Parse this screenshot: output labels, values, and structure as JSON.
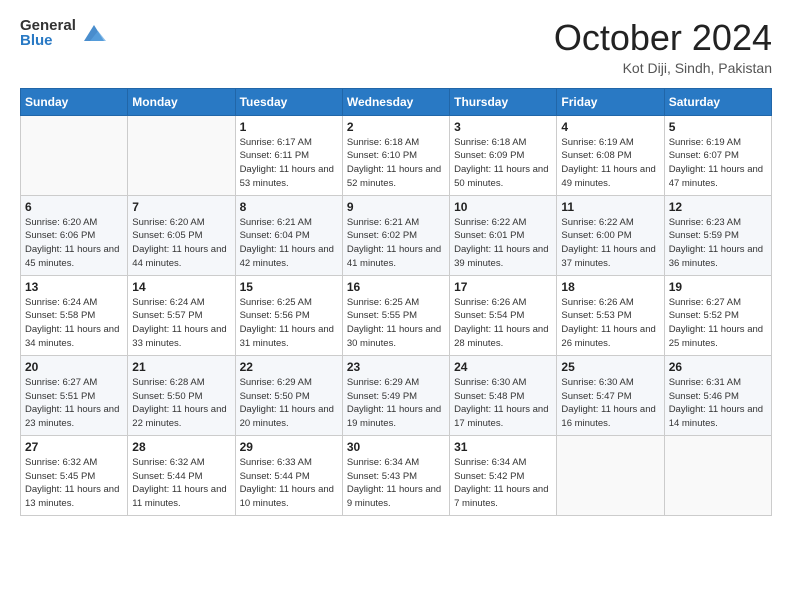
{
  "header": {
    "logo_general": "General",
    "logo_blue": "Blue",
    "month_title": "October 2024",
    "location": "Kot Diji, Sindh, Pakistan"
  },
  "weekdays": [
    "Sunday",
    "Monday",
    "Tuesday",
    "Wednesday",
    "Thursday",
    "Friday",
    "Saturday"
  ],
  "weeks": [
    [
      {
        "day": "",
        "info": ""
      },
      {
        "day": "",
        "info": ""
      },
      {
        "day": "1",
        "info": "Sunrise: 6:17 AM\nSunset: 6:11 PM\nDaylight: 11 hours and 53 minutes."
      },
      {
        "day": "2",
        "info": "Sunrise: 6:18 AM\nSunset: 6:10 PM\nDaylight: 11 hours and 52 minutes."
      },
      {
        "day": "3",
        "info": "Sunrise: 6:18 AM\nSunset: 6:09 PM\nDaylight: 11 hours and 50 minutes."
      },
      {
        "day": "4",
        "info": "Sunrise: 6:19 AM\nSunset: 6:08 PM\nDaylight: 11 hours and 49 minutes."
      },
      {
        "day": "5",
        "info": "Sunrise: 6:19 AM\nSunset: 6:07 PM\nDaylight: 11 hours and 47 minutes."
      }
    ],
    [
      {
        "day": "6",
        "info": "Sunrise: 6:20 AM\nSunset: 6:06 PM\nDaylight: 11 hours and 45 minutes."
      },
      {
        "day": "7",
        "info": "Sunrise: 6:20 AM\nSunset: 6:05 PM\nDaylight: 11 hours and 44 minutes."
      },
      {
        "day": "8",
        "info": "Sunrise: 6:21 AM\nSunset: 6:04 PM\nDaylight: 11 hours and 42 minutes."
      },
      {
        "day": "9",
        "info": "Sunrise: 6:21 AM\nSunset: 6:02 PM\nDaylight: 11 hours and 41 minutes."
      },
      {
        "day": "10",
        "info": "Sunrise: 6:22 AM\nSunset: 6:01 PM\nDaylight: 11 hours and 39 minutes."
      },
      {
        "day": "11",
        "info": "Sunrise: 6:22 AM\nSunset: 6:00 PM\nDaylight: 11 hours and 37 minutes."
      },
      {
        "day": "12",
        "info": "Sunrise: 6:23 AM\nSunset: 5:59 PM\nDaylight: 11 hours and 36 minutes."
      }
    ],
    [
      {
        "day": "13",
        "info": "Sunrise: 6:24 AM\nSunset: 5:58 PM\nDaylight: 11 hours and 34 minutes."
      },
      {
        "day": "14",
        "info": "Sunrise: 6:24 AM\nSunset: 5:57 PM\nDaylight: 11 hours and 33 minutes."
      },
      {
        "day": "15",
        "info": "Sunrise: 6:25 AM\nSunset: 5:56 PM\nDaylight: 11 hours and 31 minutes."
      },
      {
        "day": "16",
        "info": "Sunrise: 6:25 AM\nSunset: 5:55 PM\nDaylight: 11 hours and 30 minutes."
      },
      {
        "day": "17",
        "info": "Sunrise: 6:26 AM\nSunset: 5:54 PM\nDaylight: 11 hours and 28 minutes."
      },
      {
        "day": "18",
        "info": "Sunrise: 6:26 AM\nSunset: 5:53 PM\nDaylight: 11 hours and 26 minutes."
      },
      {
        "day": "19",
        "info": "Sunrise: 6:27 AM\nSunset: 5:52 PM\nDaylight: 11 hours and 25 minutes."
      }
    ],
    [
      {
        "day": "20",
        "info": "Sunrise: 6:27 AM\nSunset: 5:51 PM\nDaylight: 11 hours and 23 minutes."
      },
      {
        "day": "21",
        "info": "Sunrise: 6:28 AM\nSunset: 5:50 PM\nDaylight: 11 hours and 22 minutes."
      },
      {
        "day": "22",
        "info": "Sunrise: 6:29 AM\nSunset: 5:50 PM\nDaylight: 11 hours and 20 minutes."
      },
      {
        "day": "23",
        "info": "Sunrise: 6:29 AM\nSunset: 5:49 PM\nDaylight: 11 hours and 19 minutes."
      },
      {
        "day": "24",
        "info": "Sunrise: 6:30 AM\nSunset: 5:48 PM\nDaylight: 11 hours and 17 minutes."
      },
      {
        "day": "25",
        "info": "Sunrise: 6:30 AM\nSunset: 5:47 PM\nDaylight: 11 hours and 16 minutes."
      },
      {
        "day": "26",
        "info": "Sunrise: 6:31 AM\nSunset: 5:46 PM\nDaylight: 11 hours and 14 minutes."
      }
    ],
    [
      {
        "day": "27",
        "info": "Sunrise: 6:32 AM\nSunset: 5:45 PM\nDaylight: 11 hours and 13 minutes."
      },
      {
        "day": "28",
        "info": "Sunrise: 6:32 AM\nSunset: 5:44 PM\nDaylight: 11 hours and 11 minutes."
      },
      {
        "day": "29",
        "info": "Sunrise: 6:33 AM\nSunset: 5:44 PM\nDaylight: 11 hours and 10 minutes."
      },
      {
        "day": "30",
        "info": "Sunrise: 6:34 AM\nSunset: 5:43 PM\nDaylight: 11 hours and 9 minutes."
      },
      {
        "day": "31",
        "info": "Sunrise: 6:34 AM\nSunset: 5:42 PM\nDaylight: 11 hours and 7 minutes."
      },
      {
        "day": "",
        "info": ""
      },
      {
        "day": "",
        "info": ""
      }
    ]
  ]
}
